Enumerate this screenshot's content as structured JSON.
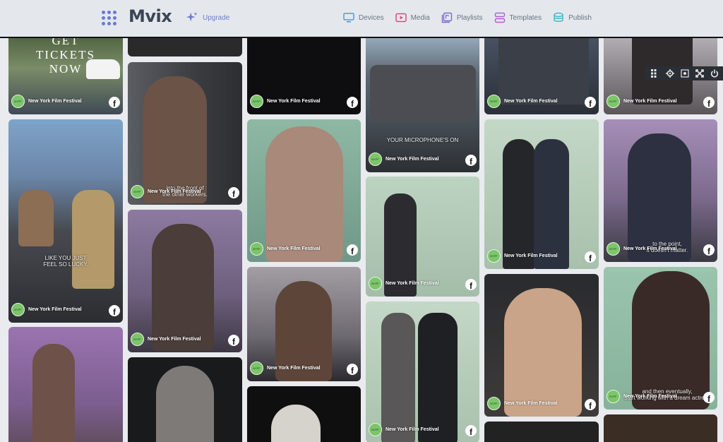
{
  "app": {
    "logo": "Mvix",
    "upgrade": "Upgrade"
  },
  "nav": [
    {
      "label": "Devices"
    },
    {
      "label": "Media"
    },
    {
      "label": "Playlists"
    },
    {
      "label": "Templates"
    },
    {
      "label": "Publish"
    }
  ],
  "toolbar": [
    "grid-icon",
    "gear-icon",
    "screenshot-icon",
    "fullscreen-icon",
    "power-icon"
  ],
  "source": "New York Film Festival",
  "colors": {
    "accent": "#6b78d6",
    "player_bg": "#1d2126",
    "source_avatar": "#7cc56b"
  },
  "cards": {
    "c1": {
      "big_text": "GET\nTICKETS\nNOW"
    },
    "c2": {
      "overlay": ""
    },
    "c3": {
      "overlay": "into the front of\nthe other workers."
    },
    "c4": {
      "overlay": "LIKE YOU JUST\nFEEL SO LUCKY."
    },
    "c5": {
      "overlay": "YOUR MICROPHONE'S ON"
    },
    "c6": {
      "overlay": "to the point,\nit doesn't matter."
    },
    "c7": {
      "overlay": "and then eventually,\nstart working with a dream actress"
    }
  }
}
